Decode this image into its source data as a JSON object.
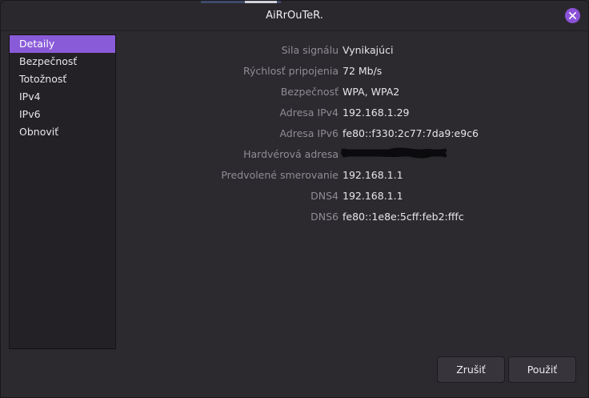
{
  "window": {
    "title": "AiRrOuTeR."
  },
  "sidebar": {
    "items": [
      {
        "label": "Detaily",
        "active": true
      },
      {
        "label": "Bezpečnosť",
        "active": false
      },
      {
        "label": "Totožnosť",
        "active": false
      },
      {
        "label": "IPv4",
        "active": false
      },
      {
        "label": "IPv6",
        "active": false
      },
      {
        "label": "Obnoviť",
        "active": false
      }
    ]
  },
  "details": {
    "rows": [
      {
        "label": "Sila signálu",
        "value": "Vynikajúci"
      },
      {
        "label": "Rýchlosť pripojenia",
        "value": "72 Mb/s"
      },
      {
        "label": "Bezpečnosť",
        "value": "WPA, WPA2"
      },
      {
        "label": "Adresa IPv4",
        "value": "192.168.1.29"
      },
      {
        "label": "Adresa IPv6",
        "value": "fe80::f330:2c77:7da9:e9c6"
      },
      {
        "label": "Hardvérová adresa",
        "value": ""
      },
      {
        "label": "Predvolené smerovanie",
        "value": "192.168.1.1"
      },
      {
        "label": "DNS4",
        "value": "192.168.1.1"
      },
      {
        "label": "DNS6",
        "value": "fe80::1e8e:5cff:feb2:fffc"
      }
    ]
  },
  "buttons": {
    "cancel": "Zrušiť",
    "apply": "Použiť"
  },
  "colors": {
    "accent": "#8a5bd8",
    "close": "#8b52d8",
    "background": "#2c2a2f",
    "label": "#8f8c95"
  },
  "icons": {
    "close": "close-icon"
  }
}
